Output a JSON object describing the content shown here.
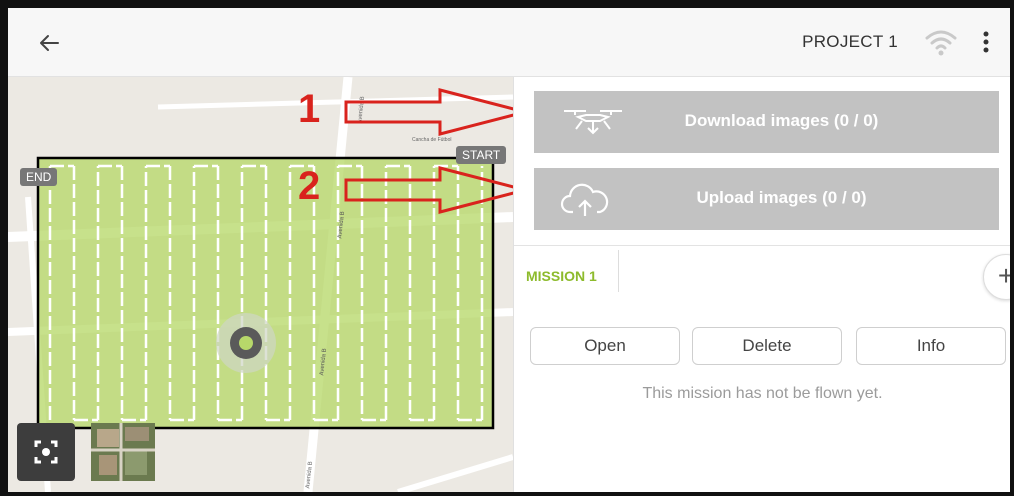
{
  "header": {
    "back_icon": "arrow-left-icon",
    "project_title": "PROJECT 1",
    "wifi_icon": "wifi-icon",
    "more_icon": "more-vert-icon"
  },
  "map": {
    "end_label": "END",
    "start_label": "START",
    "street_labels": [
      "Avenida B",
      "Avenida B",
      "Avenida B",
      "Avenida B"
    ],
    "place_label": "Cancha de Fútbol",
    "recenter_icon": "recenter-icon",
    "satellite_thumb": "satellite-layer-thumbnail"
  },
  "annotations": {
    "marker_1": "1",
    "marker_2": "2"
  },
  "actions": {
    "download_label": "Download images (0 / 0)",
    "download_icon": "drone-download-icon",
    "upload_label": "Upload images (0 / 0)",
    "upload_icon": "cloud-upload-icon"
  },
  "mission": {
    "tabs": [
      {
        "label": "MISSION 1"
      }
    ],
    "add_icon": "plus-icon",
    "buttons": {
      "open": "Open",
      "delete": "Delete",
      "info": "Info"
    },
    "status_note": "This mission has not be flown yet."
  },
  "colors": {
    "accent_green": "#8dbb2c",
    "annotation_red": "#d9231d",
    "button_gray": "#c2c2c2"
  }
}
